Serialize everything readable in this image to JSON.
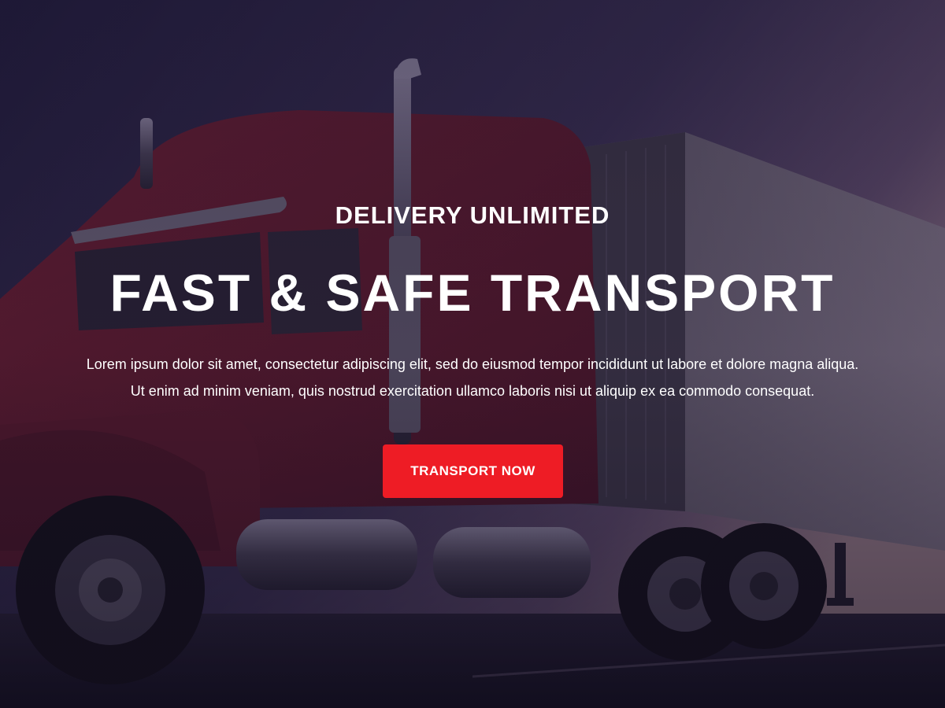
{
  "hero": {
    "eyebrow": "DELIVERY UNLIMITED",
    "headline": "FAST & SAFE TRANSPORT",
    "lead_line_1": "Lorem ipsum dolor sit amet, consectetur adipiscing elit, sed do eiusmod tempor incididunt ut labore et dolore magna aliqua.",
    "lead_line_2": "Ut enim ad minim veniam, quis nostrud exercitation ullamco laboris nisi ut aliquip ex ea commodo consequat.",
    "cta_label": "TRANSPORT NOW",
    "background_image": "truck-on-highway-photo"
  },
  "colors": {
    "cta_background": "#ee1c25",
    "text": "#ffffff",
    "overlay": "#1e1933"
  }
}
